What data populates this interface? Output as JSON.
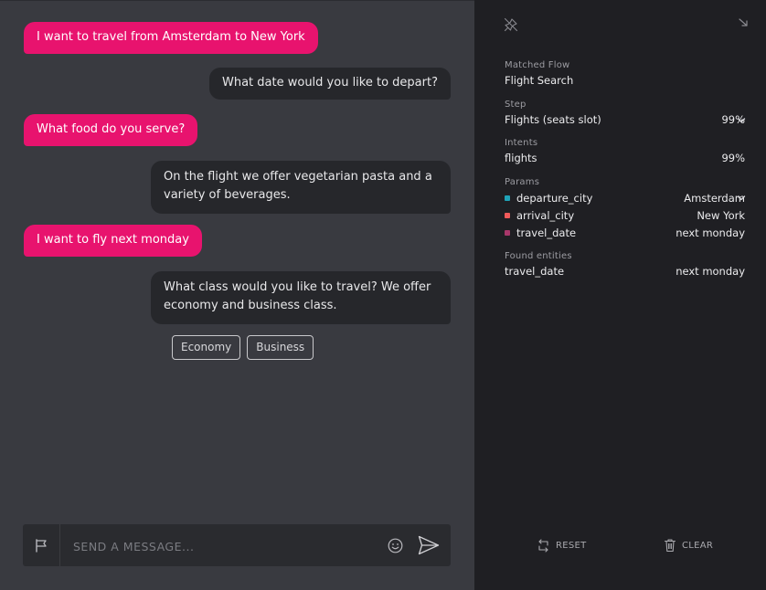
{
  "chat": {
    "messages": [
      {
        "from": "user",
        "text": "I want to travel from Amsterdam to New York"
      },
      {
        "from": "bot",
        "text": "What date would you like to depart?"
      },
      {
        "from": "user",
        "text": "What food do you serve?"
      },
      {
        "from": "bot",
        "text": "On the flight we offer vegetarian pasta and a variety of beverages."
      },
      {
        "from": "user",
        "text": "I want to fly next monday"
      },
      {
        "from": "bot",
        "text": "What class would you like to travel? We offer economy and business class."
      }
    ],
    "quick_replies": [
      "Economy",
      "Business"
    ],
    "composer": {
      "placeholder": "SEND A MESSAGE...",
      "value": ""
    }
  },
  "debug": {
    "matched_flow": {
      "label": "Matched Flow",
      "value": "Flight Search"
    },
    "step": {
      "label": "Step",
      "name": "Flights (seats slot)",
      "confidence": "99%"
    },
    "intents": {
      "label": "Intents",
      "name": "flights",
      "confidence": "99%"
    },
    "params": {
      "label": "Params",
      "items": [
        {
          "name": "departure_city",
          "value": "Amsterdam",
          "color": "#1fa3b8"
        },
        {
          "name": "arrival_city",
          "value": "New York",
          "color": "#f05a5a"
        },
        {
          "name": "travel_date",
          "value": "next monday",
          "color": "#a8376a"
        }
      ]
    },
    "found_entities": {
      "label": "Found entities",
      "items": [
        {
          "name": "travel_date",
          "value": "next monday"
        }
      ]
    },
    "actions": {
      "reset": "RESET",
      "clear": "CLEAR"
    }
  },
  "colors": {
    "user_bubble": "#e8136e",
    "bot_bubble": "#26272b",
    "chat_bg": "#393a40",
    "panel_bg": "#1f1f23"
  },
  "icons": [
    "flag-icon",
    "smiley-icon",
    "send-icon",
    "pin-off-icon",
    "collapse-icon",
    "chevron-down-icon",
    "reset-icon",
    "trash-icon"
  ]
}
